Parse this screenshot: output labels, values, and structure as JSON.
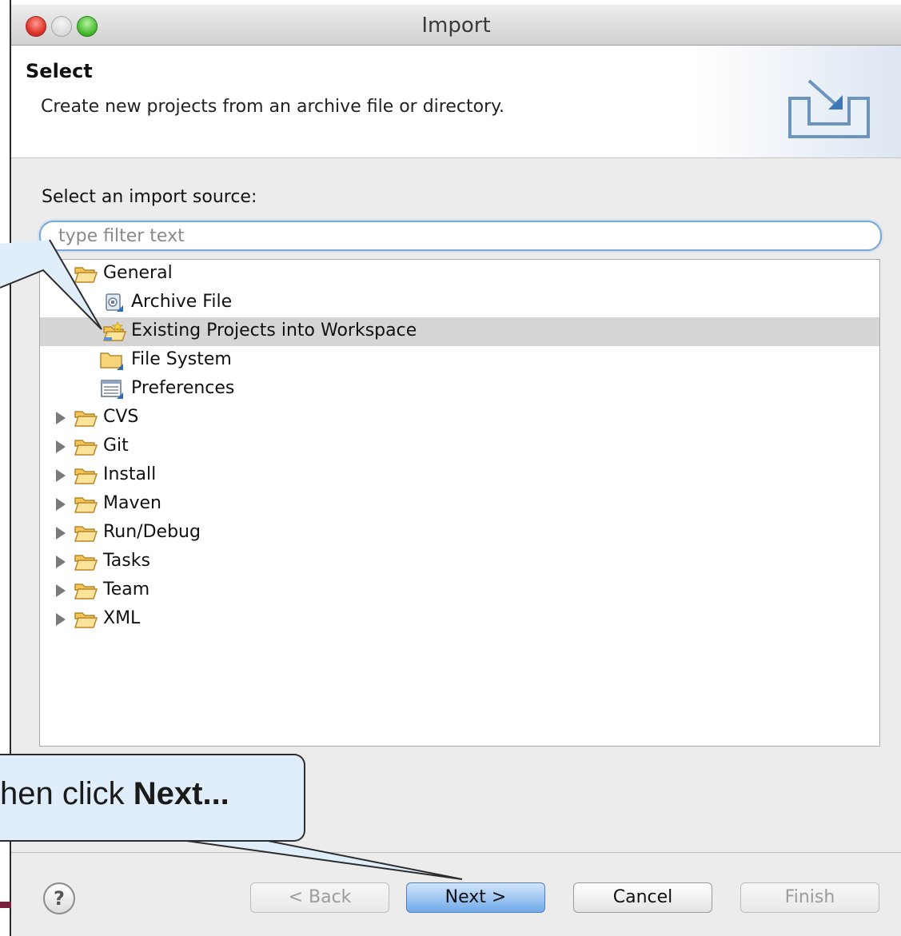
{
  "window": {
    "title": "Import"
  },
  "header": {
    "title": "Select",
    "description": "Create new projects from an archive file or directory."
  },
  "source": {
    "label": "Select an import source:",
    "filter_placeholder": "type filter text",
    "filter_value": ""
  },
  "tree": {
    "items": [
      {
        "label": "General",
        "icon": "folder-open-icon",
        "expanded": true
      },
      {
        "label": "Archive File",
        "icon": "archive-file-icon"
      },
      {
        "label": "Existing Projects into Workspace",
        "icon": "existing-projects-icon",
        "selected": true
      },
      {
        "label": "File System",
        "icon": "file-system-folder-icon"
      },
      {
        "label": "Preferences",
        "icon": "preferences-icon"
      },
      {
        "label": "CVS",
        "icon": "folder-icon",
        "expanded": false
      },
      {
        "label": "Git",
        "icon": "folder-icon",
        "expanded": false
      },
      {
        "label": "Install",
        "icon": "folder-icon",
        "expanded": false
      },
      {
        "label": "Maven",
        "icon": "folder-icon",
        "expanded": false
      },
      {
        "label": "Run/Debug",
        "icon": "folder-icon",
        "expanded": false
      },
      {
        "label": "Tasks",
        "icon": "folder-icon",
        "expanded": false
      },
      {
        "label": "Team",
        "icon": "folder-icon",
        "expanded": false
      },
      {
        "label": "XML",
        "icon": "folder-icon",
        "expanded": false
      }
    ]
  },
  "buttons": {
    "help": "?",
    "back": "< Back",
    "next": "Next >",
    "cancel": "Cancel",
    "finish": "Finish"
  },
  "callout": {
    "prefix": "hen click ",
    "bold": "Next..."
  },
  "colors": {
    "selection": "#d5d5d5",
    "default_button": "#6fa9e8",
    "callout_fill": "#dfeefa"
  }
}
